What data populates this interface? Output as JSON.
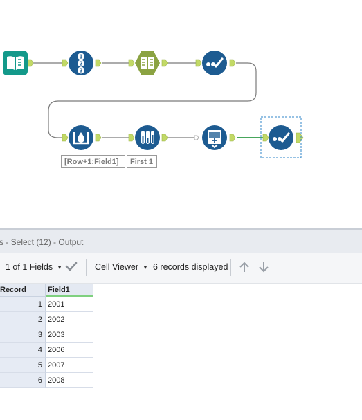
{
  "workflow": {
    "annotations": {
      "formula_label": "[Row+1:Field1]",
      "sample_label": "First 1"
    },
    "icons": [
      "input-data-book-icon",
      "record-id-icon",
      "text-to-columns-icon",
      "select-check-icon",
      "multi-row-formula-icon",
      "sample-test-tubes-icon",
      "append-fields-icon",
      "select-check-selected-icon"
    ],
    "colors": {
      "teal": "#13998a",
      "navy": "#1d5b91",
      "olive": "#8ba342",
      "connector_anchor": "#c2d966"
    }
  },
  "results": {
    "title": "s - Select (12) - Output",
    "toolbar": {
      "fields_label": "1 of 1 Fields",
      "viewer_label": "Cell Viewer",
      "records_label": "6 records displayed"
    },
    "grid": {
      "headers": [
        "Record",
        "Field1"
      ],
      "rows": [
        {
          "record": "1",
          "field1": "2001"
        },
        {
          "record": "2",
          "field1": "2002"
        },
        {
          "record": "3",
          "field1": "2003"
        },
        {
          "record": "4",
          "field1": "2006"
        },
        {
          "record": "5",
          "field1": "2007"
        },
        {
          "record": "6",
          "field1": "2008"
        }
      ]
    }
  }
}
